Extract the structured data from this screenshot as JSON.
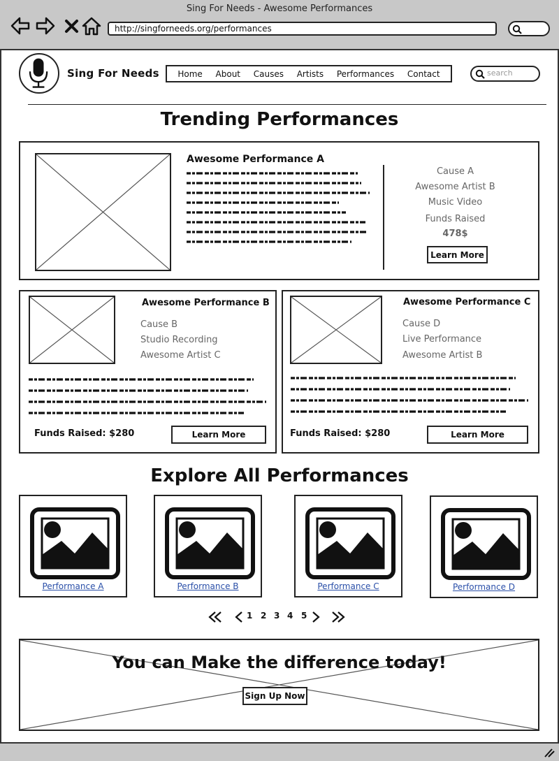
{
  "browser": {
    "window_title": "Sing For Needs - Awesome Performances",
    "url": "http://singforneeds.org/performances"
  },
  "header": {
    "site_name": "Sing For Needs",
    "nav": [
      "Home",
      "About",
      "Causes",
      "Artists",
      "Performances",
      "Contact"
    ],
    "search_placeholder": "search"
  },
  "trending": {
    "heading": "Trending Performances",
    "featured": {
      "title": "Awesome Performance A",
      "cause": "Cause A",
      "artist": "Awesome Artist B",
      "type": "Music Video",
      "funds_label": "Funds Raised",
      "funds_value": "478$",
      "button": "Learn More"
    },
    "cards": [
      {
        "title": "Awesome Performance B",
        "cause": "Cause B",
        "type": "Studio Recording",
        "artist": "Awesome Artist C",
        "funds": "Funds Raised: $280",
        "button": "Learn More"
      },
      {
        "title": "Awesome Performance C",
        "cause": "Cause D",
        "type": "Live Performance",
        "artist": "Awesome Artist B",
        "funds": "Funds Raised: $280",
        "button": "Learn More"
      }
    ]
  },
  "explore": {
    "heading": "Explore All Performances",
    "items": [
      "Performance A",
      "Performance B",
      "Performance C",
      "Performance D"
    ],
    "pages": [
      "1",
      "2",
      "3",
      "4",
      "5"
    ]
  },
  "banner": {
    "text": "You can Make the difference today!",
    "button": "Sign Up Now"
  },
  "colors": {
    "chrome": "#c8c8c8",
    "link": "#2a4fa8",
    "muted_text": "#666666"
  }
}
